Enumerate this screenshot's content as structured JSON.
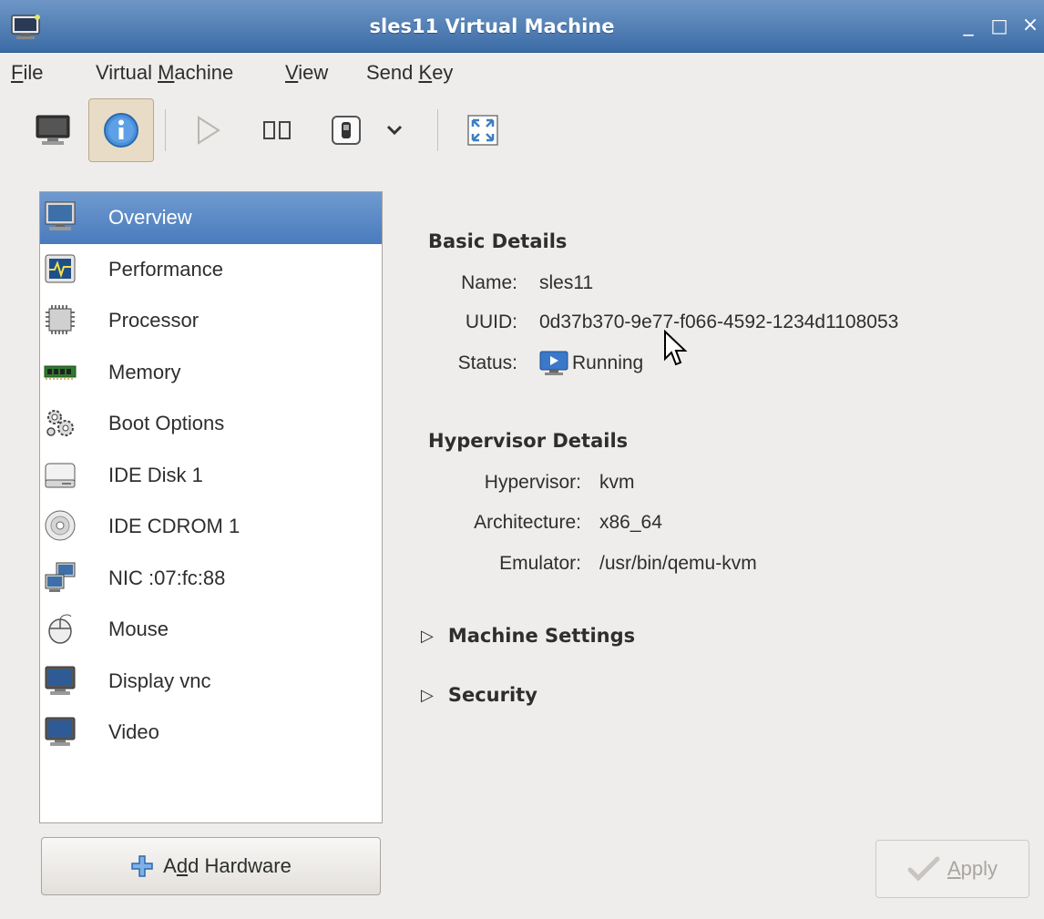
{
  "window": {
    "title": "sles11 Virtual Machine",
    "minimize_glyph": "_",
    "maximize_glyph": "□",
    "close_glyph": "×"
  },
  "menubar": {
    "items": [
      {
        "prefix": "",
        "mnemonic": "F",
        "suffix": "ile"
      },
      {
        "prefix": "Virtual ",
        "mnemonic": "M",
        "suffix": "achine"
      },
      {
        "prefix": "",
        "mnemonic": "V",
        "suffix": "iew"
      },
      {
        "prefix": "Send ",
        "mnemonic": "K",
        "suffix": "ey"
      }
    ]
  },
  "toolbar": {
    "icons": [
      "console-monitor-icon",
      "info-icon",
      "play-icon",
      "pause-icon",
      "shutdown-icon",
      "chevron-down-icon",
      "fullscreen-icon"
    ]
  },
  "sidebar": {
    "items": [
      {
        "label": "Overview",
        "icon": "monitor-icon"
      },
      {
        "label": "Performance",
        "icon": "performance-graph-icon"
      },
      {
        "label": "Processor",
        "icon": "cpu-chip-icon"
      },
      {
        "label": "Memory",
        "icon": "memory-stick-icon"
      },
      {
        "label": "Boot Options",
        "icon": "gears-icon"
      },
      {
        "label": "IDE Disk 1",
        "icon": "hard-disk-icon"
      },
      {
        "label": "IDE CDROM 1",
        "icon": "cdrom-icon"
      },
      {
        "label": "NIC :07:fc:88",
        "icon": "network-icon"
      },
      {
        "label": "Mouse",
        "icon": "mouse-icon"
      },
      {
        "label": "Display vnc",
        "icon": "display-icon"
      },
      {
        "label": "Video",
        "icon": "video-icon"
      }
    ],
    "selected_index": 0
  },
  "basic_details": {
    "title": "Basic Details",
    "name_label": "Name:",
    "name_value": "sles11",
    "uuid_label": "UUID:",
    "uuid_value": "0d37b370-9e77-f066-4592-1234d1108053",
    "status_label": "Status:",
    "status_value": "Running"
  },
  "hypervisor_details": {
    "title": "Hypervisor Details",
    "hypervisor_label": "Hypervisor:",
    "hypervisor_value": "kvm",
    "architecture_label": "Architecture:",
    "architecture_value": "x86_64",
    "emulator_label": "Emulator:",
    "emulator_value": "/usr/bin/qemu-kvm"
  },
  "expanders": {
    "machine_settings": "Machine Settings",
    "security": "Security"
  },
  "buttons": {
    "add_hardware_prefix": "A",
    "add_hardware_mnemonic": "d",
    "add_hardware_suffix": "d Hardware",
    "apply_mnemonic": "A",
    "apply_suffix": "pply"
  },
  "colors": {
    "titlebar": "#4f7fb8",
    "selection": "#5a88c4",
    "window_bg": "#efedeb"
  }
}
